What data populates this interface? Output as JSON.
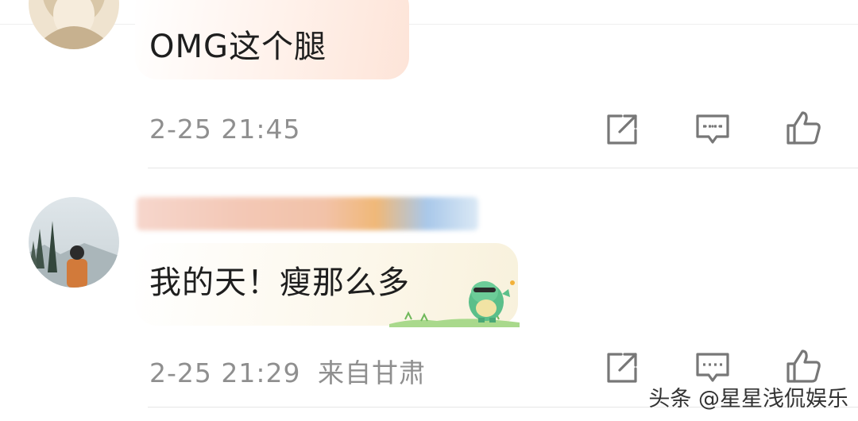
{
  "comments": [
    {
      "text": "OMG这个腿",
      "time": "2-25 21:45",
      "location": ""
    },
    {
      "text": "我的天！瘦那么多",
      "time": "2-25 21:29",
      "location": "来自甘肃"
    }
  ],
  "actions": {
    "share_icon": "share-box-icon",
    "reply_icon": "comment-bubble-icon",
    "like_icon": "thumbs-up-icon"
  },
  "watermark": "头条 @星星浅侃娱乐",
  "colors": {
    "accent": "#f0a020",
    "meta_text": "#8f8f8f",
    "icon": "#777777",
    "bubble_peach": "#fde9df",
    "bubble_cream": "#fbf6e8"
  }
}
